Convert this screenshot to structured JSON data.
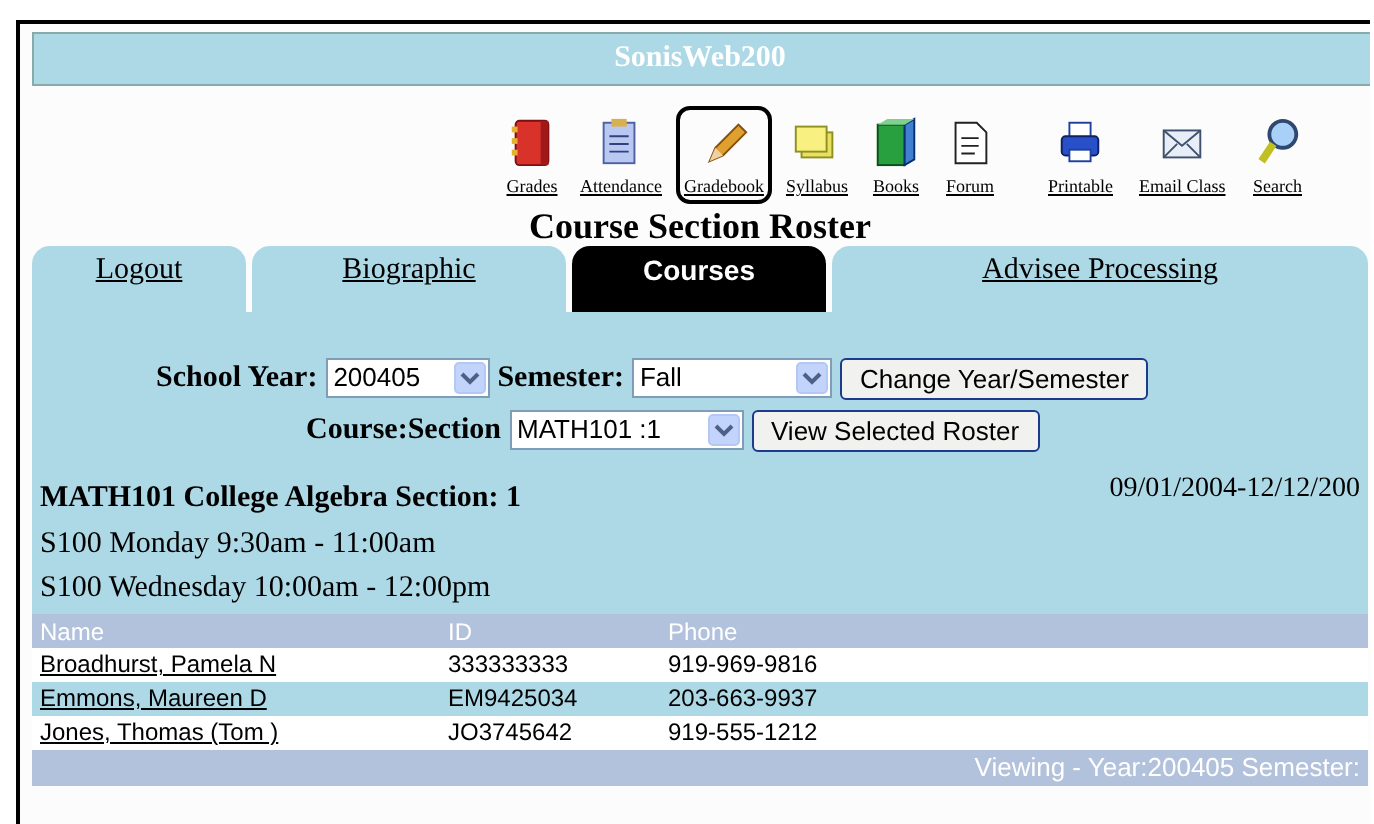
{
  "window": {
    "title": "SonisWeb200"
  },
  "toolbar": {
    "groups": [
      [
        {
          "label": "Grades",
          "selected": false
        },
        {
          "label": "Attendance",
          "selected": false
        },
        {
          "label": "Gradebook",
          "selected": true
        },
        {
          "label": "Syllabus",
          "selected": false
        },
        {
          "label": "Books",
          "selected": false
        },
        {
          "label": "Forum",
          "selected": false
        }
      ],
      [
        {
          "label": "Printable",
          "selected": false
        },
        {
          "label": "Email Class",
          "selected": false
        },
        {
          "label": "Search",
          "selected": false
        }
      ]
    ]
  },
  "page_title": "Course Section Roster",
  "tabs": [
    {
      "label": "Logout",
      "selected": false
    },
    {
      "label": "Biographic",
      "selected": false
    },
    {
      "label": "Courses",
      "selected": true
    },
    {
      "label": "Advisee Processing",
      "selected": false
    }
  ],
  "form": {
    "school_year_label": "School Year:",
    "school_year": "200405",
    "semester_label": "Semester:",
    "semester": "Fall",
    "change_button": "Change Year/Semester",
    "section_label": "Course:Section",
    "section": "MATH101 :1",
    "view_button": "View Selected Roster"
  },
  "course": {
    "title": "MATH101 College Algebra Section: 1",
    "dates": "09/01/2004-12/12/200",
    "meetings": [
      "S100 Monday 9:30am - 11:00am",
      "S100 Wednesday 10:00am - 12:00pm"
    ]
  },
  "table": {
    "columns": [
      "Name",
      "ID",
      "Phone"
    ],
    "rows": [
      {
        "name": "Broadhurst, Pamela N",
        "id": "333333333",
        "phone": "919-969-9816"
      },
      {
        "name": "Emmons, Maureen D",
        "id": "EM9425034",
        "phone": "203-663-9937"
      },
      {
        "name": "Jones, Thomas (Tom )",
        "id": "JO3745642",
        "phone": "919-555-1212"
      }
    ]
  },
  "status_bar": "Viewing - Year:200405 Semester:"
}
